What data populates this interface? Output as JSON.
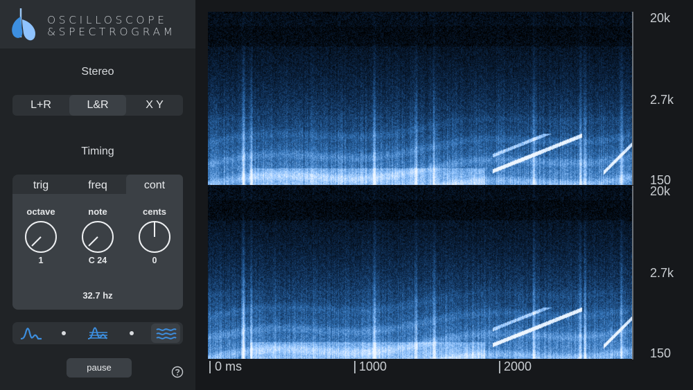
{
  "app": {
    "title_line1": "OSCILLOSCOPE",
    "title_line2": "&SPECTROGRAM",
    "accent_color": "#3d8fe0"
  },
  "stereo": {
    "title": "Stereo",
    "options": [
      "L+R",
      "L&R",
      "X Y"
    ],
    "selected": "L&R"
  },
  "timing": {
    "title": "Timing",
    "tabs": [
      "trig",
      "freq",
      "cont"
    ],
    "selected_tab": "cont",
    "octave": {
      "label": "octave",
      "value": "1"
    },
    "note": {
      "label": "note",
      "value": "C 24"
    },
    "cents": {
      "label": "cents",
      "value": "0"
    },
    "frequency": "32.7 hz"
  },
  "view_modes": {
    "icons": [
      "oscilloscope-wave-icon",
      "combined-wave-icon",
      "spectrogram-waves-icon"
    ],
    "selected": "spectrogram-waves-icon"
  },
  "controls": {
    "pause_label": "pause",
    "help_icon": "question-circle-icon"
  },
  "spectrogram": {
    "channels": 2,
    "y_ticks": [
      "20k",
      "2.7k",
      "150"
    ],
    "x_ticks": [
      "0 ms",
      "1000",
      "2000"
    ],
    "colormap": [
      "#000000",
      "#0d2a4e",
      "#2f6fb3",
      "#8fc3ff",
      "#eef6ff"
    ]
  }
}
